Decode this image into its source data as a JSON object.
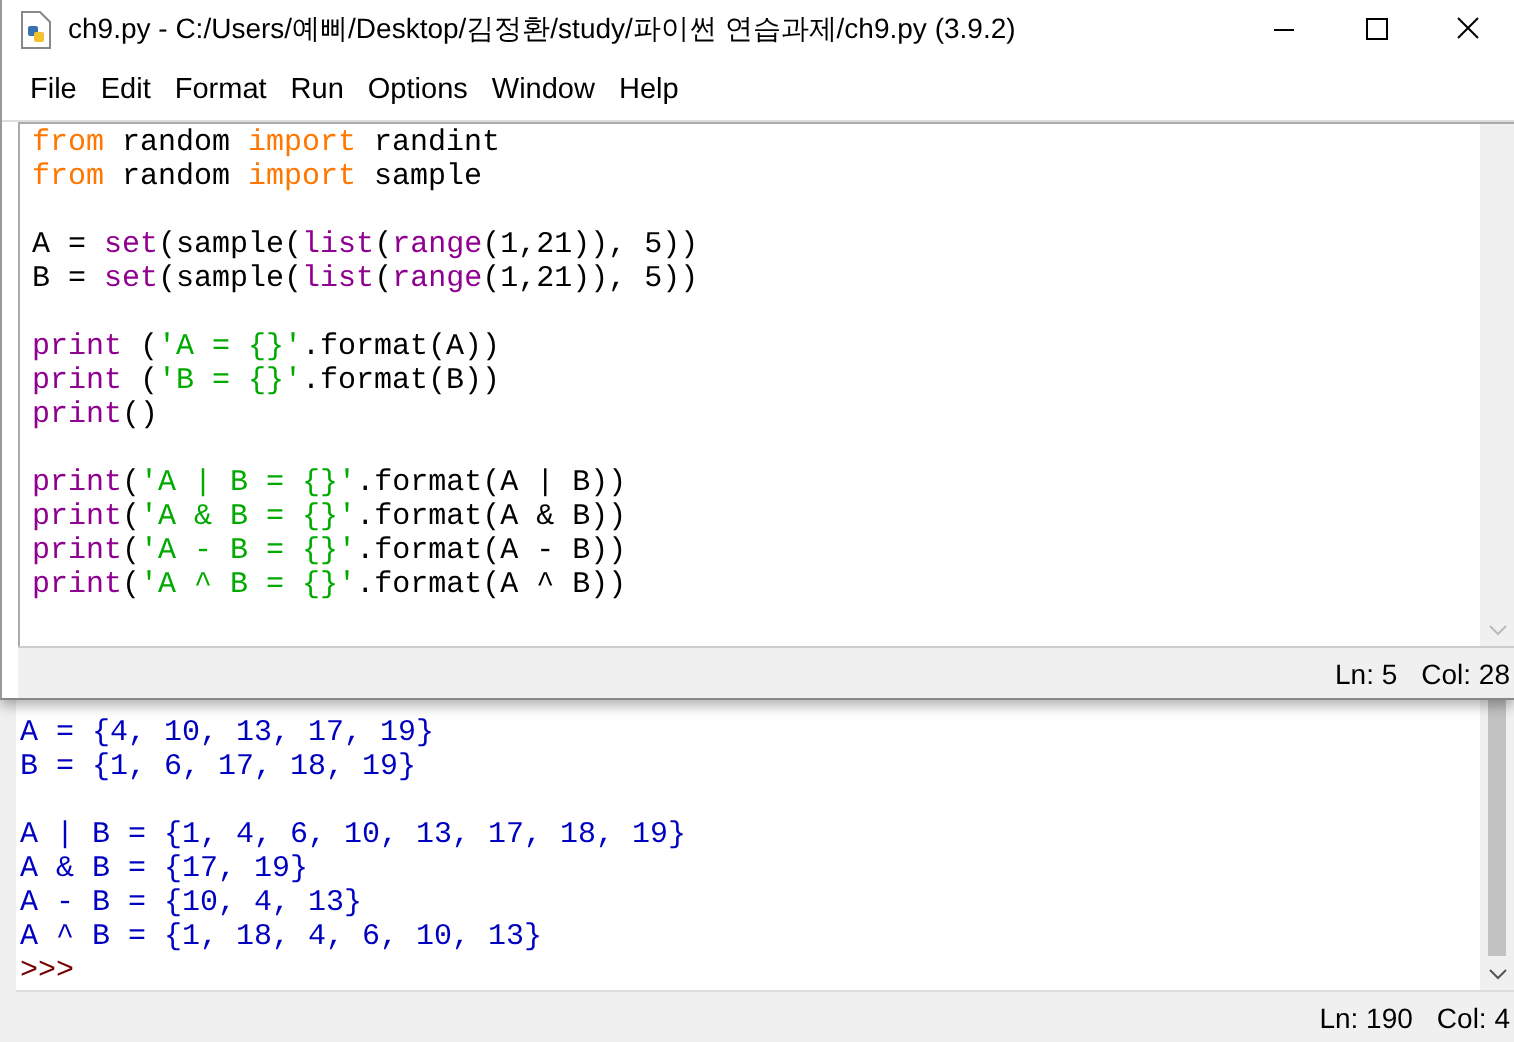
{
  "editor_window": {
    "title": "ch9.py - C:/Users/예삐/Desktop/김정환/study/파이썬 연습과제/ch9.py (3.9.2)",
    "menu": [
      "File",
      "Edit",
      "Format",
      "Run",
      "Options",
      "Window",
      "Help"
    ],
    "code_lines": [
      {
        "kind": "code",
        "tokens": [
          {
            "text": "from",
            "kind": "keyword"
          },
          {
            "text": " random ",
            "kind": "plain"
          },
          {
            "text": "import",
            "kind": "keyword"
          },
          {
            "text": " randint",
            "kind": "plain"
          }
        ]
      },
      {
        "kind": "code",
        "tokens": [
          {
            "text": "from",
            "kind": "keyword"
          },
          {
            "text": " random ",
            "kind": "plain"
          },
          {
            "text": "import",
            "kind": "keyword"
          },
          {
            "text": " sample",
            "kind": "plain"
          }
        ]
      },
      {
        "kind": "blank"
      },
      {
        "kind": "code",
        "tokens": [
          {
            "text": "A = ",
            "kind": "plain"
          },
          {
            "text": "set",
            "kind": "builtin"
          },
          {
            "text": "(sample(",
            "kind": "plain"
          },
          {
            "text": "list",
            "kind": "builtin"
          },
          {
            "text": "(",
            "kind": "plain"
          },
          {
            "text": "range",
            "kind": "builtin"
          },
          {
            "text": "(1,21)), 5))",
            "kind": "plain"
          }
        ]
      },
      {
        "kind": "code",
        "tokens": [
          {
            "text": "B = ",
            "kind": "plain"
          },
          {
            "text": "set",
            "kind": "builtin"
          },
          {
            "text": "(sample(",
            "kind": "plain"
          },
          {
            "text": "list",
            "kind": "builtin"
          },
          {
            "text": "(",
            "kind": "plain"
          },
          {
            "text": "range",
            "kind": "builtin"
          },
          {
            "text": "(1,21)), 5))",
            "kind": "plain"
          }
        ]
      },
      {
        "kind": "blank"
      },
      {
        "kind": "code",
        "tokens": [
          {
            "text": "print",
            "kind": "builtin"
          },
          {
            "text": " (",
            "kind": "plain"
          },
          {
            "text": "'A = {}'",
            "kind": "string"
          },
          {
            "text": ".format(A))",
            "kind": "plain"
          }
        ]
      },
      {
        "kind": "code",
        "tokens": [
          {
            "text": "print",
            "kind": "builtin"
          },
          {
            "text": " (",
            "kind": "plain"
          },
          {
            "text": "'B = {}'",
            "kind": "string"
          },
          {
            "text": ".format(B))",
            "kind": "plain"
          }
        ]
      },
      {
        "kind": "code",
        "tokens": [
          {
            "text": "print",
            "kind": "builtin"
          },
          {
            "text": "()",
            "kind": "plain"
          }
        ]
      },
      {
        "kind": "blank"
      },
      {
        "kind": "code",
        "tokens": [
          {
            "text": "print",
            "kind": "builtin"
          },
          {
            "text": "(",
            "kind": "plain"
          },
          {
            "text": "'A | B = {}'",
            "kind": "string"
          },
          {
            "text": ".format(A | B))",
            "kind": "plain"
          }
        ]
      },
      {
        "kind": "code",
        "tokens": [
          {
            "text": "print",
            "kind": "builtin"
          },
          {
            "text": "(",
            "kind": "plain"
          },
          {
            "text": "'A & B = {}'",
            "kind": "string"
          },
          {
            "text": ".format(A & B))",
            "kind": "plain"
          }
        ]
      },
      {
        "kind": "code",
        "tokens": [
          {
            "text": "print",
            "kind": "builtin"
          },
          {
            "text": "(",
            "kind": "plain"
          },
          {
            "text": "'A - B = {}'",
            "kind": "string"
          },
          {
            "text": ".format(A - B))",
            "kind": "plain"
          }
        ]
      },
      {
        "kind": "code",
        "tokens": [
          {
            "text": "print",
            "kind": "builtin"
          },
          {
            "text": "(",
            "kind": "plain"
          },
          {
            "text": "'A ^ B = {}'",
            "kind": "string"
          },
          {
            "text": ".format(A ^ B))",
            "kind": "plain"
          }
        ]
      }
    ],
    "status": {
      "line": "Ln: 5",
      "column": "Col: 28"
    }
  },
  "shell_window": {
    "lines": [
      {
        "kind": "output",
        "text": "A = {4, 10, 13, 17, 19}"
      },
      {
        "kind": "output",
        "text": "B = {1, 6, 17, 18, 19}"
      },
      {
        "kind": "blank"
      },
      {
        "kind": "output",
        "text": "A | B = {1, 4, 6, 10, 13, 17, 18, 19}"
      },
      {
        "kind": "output",
        "text": "A & B = {17, 19}"
      },
      {
        "kind": "output",
        "text": "A - B = {10, 4, 13}"
      },
      {
        "kind": "output",
        "text": "A ^ B = {1, 18, 4, 6, 10, 13}"
      },
      {
        "kind": "prompt",
        "text": ">>>"
      }
    ],
    "status": {
      "line": "Ln: 190",
      "column": "Col: 4"
    }
  }
}
